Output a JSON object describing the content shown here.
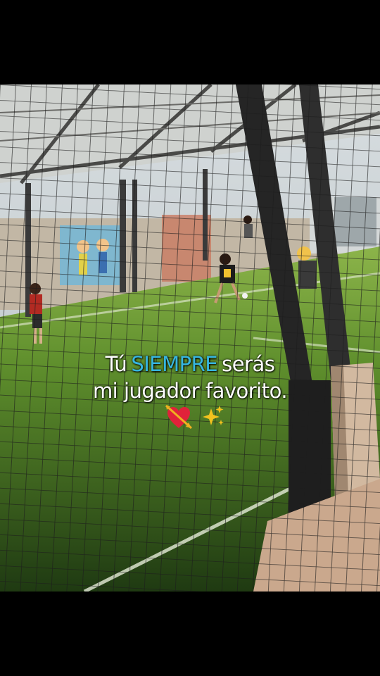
{
  "caption": {
    "word1": "Tú",
    "highlight": "SIEMPRE",
    "word2": "serás",
    "line2": "mi jugador favorito."
  },
  "emojis": [
    "heart-with-arrow-icon",
    "sparkles-icon"
  ],
  "colors": {
    "highlight": "#36b6e0",
    "turf": "#5a8a2e",
    "roof": "#c9ccc9"
  }
}
